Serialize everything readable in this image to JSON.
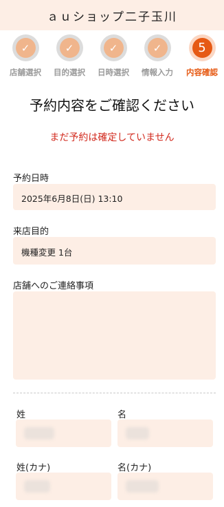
{
  "header": {
    "title": "ａｕショップ二子玉川"
  },
  "steps": [
    {
      "label": "店舗選択",
      "icon": "check-icon",
      "symbol": "✓"
    },
    {
      "label": "目的選択",
      "icon": "check-icon",
      "symbol": "✓"
    },
    {
      "label": "日時選択",
      "icon": "check-icon",
      "symbol": "✓"
    },
    {
      "label": "情報入力",
      "icon": "check-icon",
      "symbol": "✓"
    },
    {
      "label": "内容確認",
      "icon": "step-number",
      "symbol": "5"
    }
  ],
  "main": {
    "title": "予約内容をご確認ください",
    "warning": "まだ予約は確定していません"
  },
  "reservation": {
    "date_label": "予約日時",
    "date_value": "2025年6月8日(日) 13:10",
    "purpose_label": "来店目的",
    "purpose_value": "機種変更 1台",
    "notes_label": "店舗へのご連絡事項",
    "notes_value": ""
  },
  "customer": {
    "last_name_label": "姓",
    "first_name_label": "名",
    "last_name_kana_label": "姓(カナ)",
    "first_name_kana_label": "名(カナ)"
  },
  "colors": {
    "accent": "#e65a14",
    "completed": "#f0b58c",
    "field_bg": "#fdeee5",
    "warning": "#d22a1e"
  }
}
